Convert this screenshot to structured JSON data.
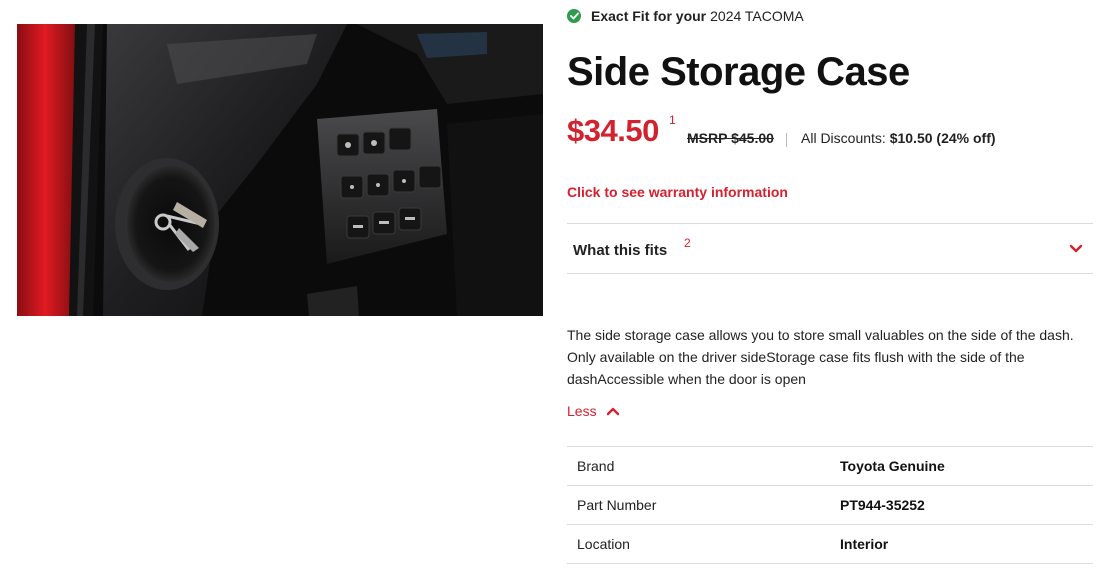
{
  "fitment": {
    "label": "Exact Fit for your",
    "vehicle": "2024 TACOMA"
  },
  "product": {
    "title": "Side Storage Case",
    "price": "$34.50",
    "price_footnote": "1",
    "msrp": "MSRP $45.00",
    "discounts_label": "All Discounts:",
    "discounts_value": "$10.50 (24% off)"
  },
  "warranty": {
    "link_label": "Click to see warranty information"
  },
  "fits": {
    "label": "What this fits",
    "footnote": "2"
  },
  "description": {
    "text": "The side storage case allows you to store small valuables on the side of the dash. Only available on the driver sideStorage case fits flush with the side of the dashAccessible when the door is open",
    "toggle_label": "Less"
  },
  "specs": [
    {
      "key": "Brand",
      "value": "Toyota Genuine"
    },
    {
      "key": "Part Number",
      "value": "PT944-35252"
    },
    {
      "key": "Location",
      "value": "Interior"
    }
  ],
  "colors": {
    "accent_red": "#d4212f",
    "check_green": "#2e9b4d",
    "divider": "#dcdcdc"
  },
  "icons": {
    "fit": "check-circle-icon",
    "accordion": "chevron-down-icon",
    "toggle": "chevron-up-icon"
  }
}
